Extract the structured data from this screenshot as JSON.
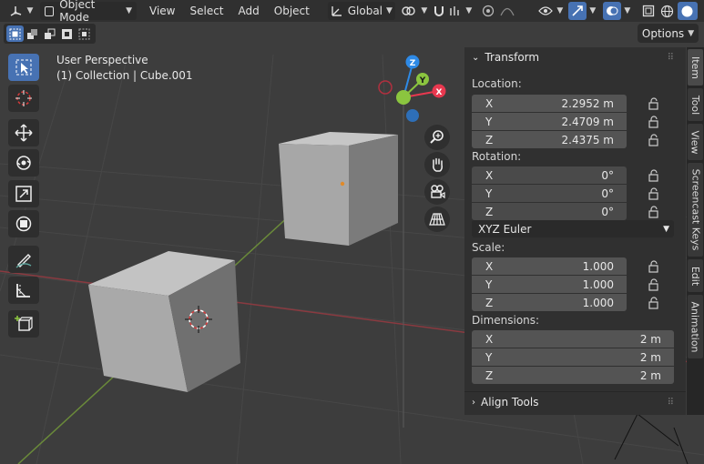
{
  "header": {
    "mode_label": "Object Mode",
    "menus": [
      "View",
      "Select",
      "Add",
      "Object"
    ],
    "orientation_label": "Global"
  },
  "options_label": "Options",
  "overlay": {
    "view_name": "User Perspective",
    "collection_info": "(1) Collection | Cube.001"
  },
  "gizmo": {
    "x_label": "X",
    "y_label": "Y",
    "z_label": "Z"
  },
  "n_panel": {
    "transform_title": "Transform",
    "location_label": "Location:",
    "location": [
      {
        "axis": "X",
        "value": "2.2952 m"
      },
      {
        "axis": "Y",
        "value": "2.4709 m"
      },
      {
        "axis": "Z",
        "value": "2.4375 m"
      }
    ],
    "rotation_label": "Rotation:",
    "rotation": [
      {
        "axis": "X",
        "value": "0°"
      },
      {
        "axis": "Y",
        "value": "0°"
      },
      {
        "axis": "Z",
        "value": "0°"
      }
    ],
    "rotation_mode": "XYZ Euler",
    "scale_label": "Scale:",
    "scale": [
      {
        "axis": "X",
        "value": "1.000"
      },
      {
        "axis": "Y",
        "value": "1.000"
      },
      {
        "axis": "Z",
        "value": "1.000"
      }
    ],
    "dimensions_label": "Dimensions:",
    "dimensions": [
      {
        "axis": "X",
        "value": "2 m"
      },
      {
        "axis": "Y",
        "value": "2 m"
      },
      {
        "axis": "Z",
        "value": "2 m"
      }
    ],
    "align_tools_title": "Align Tools"
  },
  "side_tabs": [
    "Item",
    "Tool",
    "View",
    "Screencast Keys",
    "Edit",
    "Animation"
  ],
  "colors": {
    "accent": "#4772b3",
    "x_axis": "#e8384f",
    "y_axis": "#8bc53f",
    "z_axis": "#2e8ae6"
  }
}
